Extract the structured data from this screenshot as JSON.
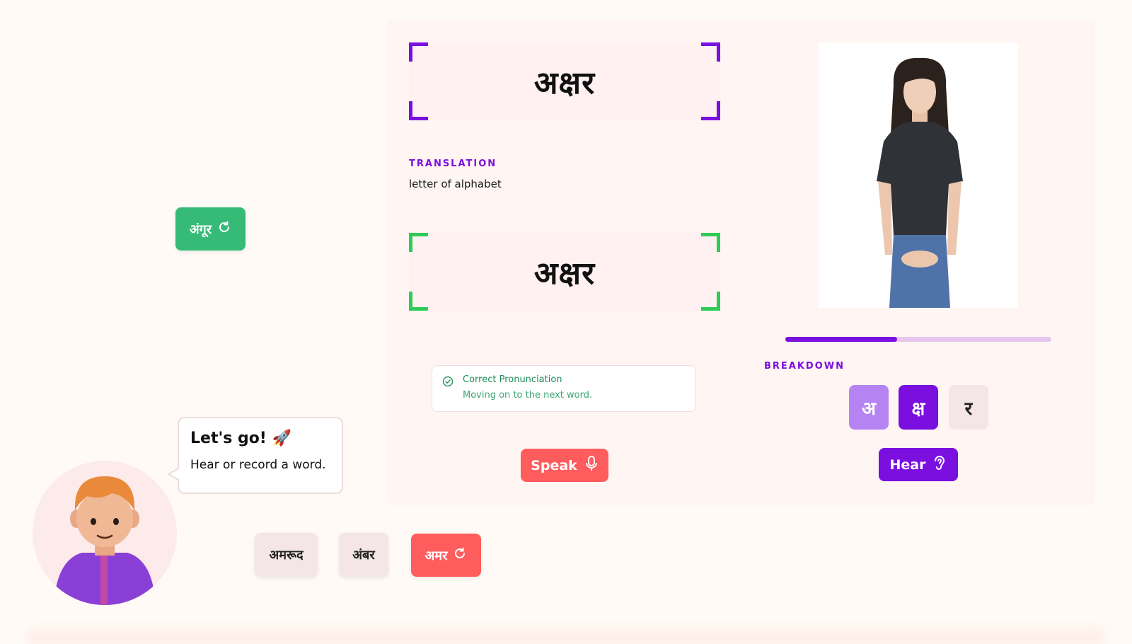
{
  "main": {
    "target_word": "अक्षर",
    "translation_label": "TRANSLATION",
    "translation_text": "letter of alphabet",
    "spoken_word": "अक्षर",
    "status": {
      "title": "Correct Pronunciation",
      "subtitle": "Moving on to the next word.",
      "icon": "check-circle-icon"
    },
    "speak_button": "Speak"
  },
  "tutor_panel": {
    "progress_fraction": 0.42,
    "breakdown_label": "BREAKDOWN",
    "syllables": [
      "अ",
      "क्ष",
      "र"
    ],
    "hear_button": "Hear"
  },
  "word_chips": {
    "left_chip": "अंगूर",
    "bottom": [
      "अमरूद",
      "अंबर"
    ],
    "active_chip": "अमर"
  },
  "assistant": {
    "bubble_title": "Let's go! 🚀",
    "bubble_text": "Hear or record a word."
  },
  "colors": {
    "accent_purple": "#7a0fe0",
    "accent_red": "#ff5c5e",
    "accent_green": "#36bb77",
    "background": "#fffaf5"
  }
}
